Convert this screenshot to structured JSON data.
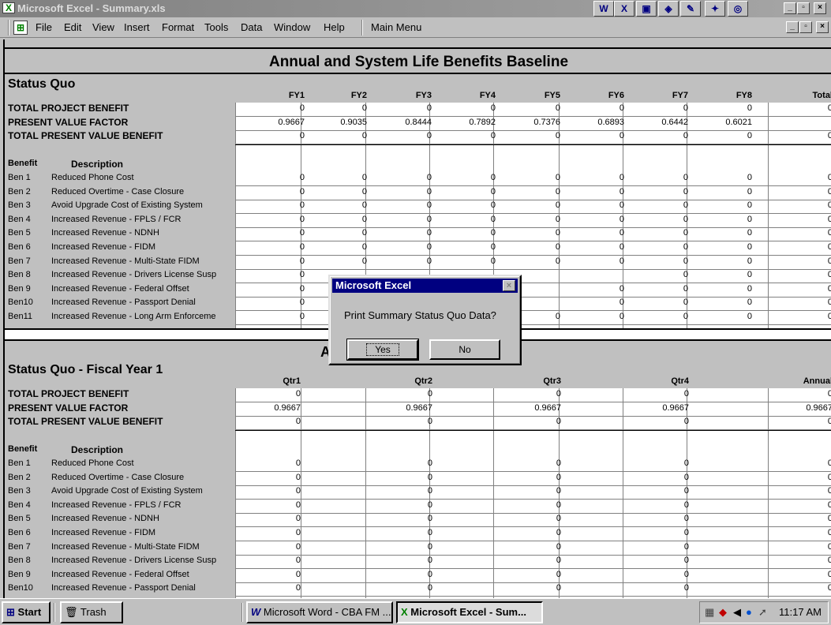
{
  "window": {
    "title": "Microsoft Excel - Summary.xls",
    "app_icon": "excel-icon",
    "office_shortcuts": [
      "W",
      "X",
      "▣",
      "◈",
      "✎",
      "✦",
      "◎"
    ],
    "controls": [
      "_",
      "▫",
      "×"
    ]
  },
  "menu": {
    "items": [
      "File",
      "Edit",
      "View",
      "Insert",
      "Format",
      "Tools",
      "Data",
      "Window",
      "Help",
      "Main Menu"
    ],
    "doc_controls": [
      "_",
      "▫",
      "×"
    ]
  },
  "sheet": {
    "main_title": "Annual and System Life Benefits Baseline",
    "section1": {
      "title": "Status Quo",
      "columns": [
        "FY1",
        "FY2",
        "FY3",
        "FY4",
        "FY5",
        "FY6",
        "FY7",
        "FY8",
        "Total"
      ],
      "summary_rows": [
        {
          "label": "TOTAL PROJECT BENEFIT",
          "values": [
            "0",
            "0",
            "0",
            "0",
            "0",
            "0",
            "0",
            "0",
            "0"
          ]
        },
        {
          "label": "PRESENT VALUE FACTOR",
          "values": [
            "0.9667",
            "0.9035",
            "0.8444",
            "0.7892",
            "0.7376",
            "0.6893",
            "0.6442",
            "0.6021",
            ""
          ]
        },
        {
          "label": "TOTAL PRESENT VALUE BENEFIT",
          "values": [
            "0",
            "0",
            "0",
            "0",
            "0",
            "0",
            "0",
            "0",
            "0"
          ]
        }
      ],
      "benefit_header": "Benefit",
      "description_header": "Description",
      "benefits": [
        {
          "code": "Ben 1",
          "desc": "Reduced Phone Cost",
          "values": [
            "0",
            "0",
            "0",
            "0",
            "0",
            "0",
            "0",
            "0",
            "0"
          ]
        },
        {
          "code": "Ben 2",
          "desc": "Reduced Overtime - Case Closure",
          "values": [
            "0",
            "0",
            "0",
            "0",
            "0",
            "0",
            "0",
            "0",
            "0"
          ]
        },
        {
          "code": "Ben 3",
          "desc": "Avoid Upgrade Cost of Existing System",
          "values": [
            "0",
            "0",
            "0",
            "0",
            "0",
            "0",
            "0",
            "0",
            "0"
          ]
        },
        {
          "code": "Ben 4",
          "desc": "Increased Revenue - FPLS / FCR",
          "values": [
            "0",
            "0",
            "0",
            "0",
            "0",
            "0",
            "0",
            "0",
            "0"
          ]
        },
        {
          "code": "Ben 5",
          "desc": "Increased Revenue - NDNH",
          "values": [
            "0",
            "0",
            "0",
            "0",
            "0",
            "0",
            "0",
            "0",
            "0"
          ]
        },
        {
          "code": "Ben 6",
          "desc": "Increased Revenue - FIDM",
          "values": [
            "0",
            "0",
            "0",
            "0",
            "0",
            "0",
            "0",
            "0",
            "0"
          ]
        },
        {
          "code": "Ben 7",
          "desc": "Increased Revenue - Multi-State FIDM",
          "values": [
            "0",
            "0",
            "0",
            "0",
            "0",
            "0",
            "0",
            "0",
            "0"
          ]
        },
        {
          "code": "Ben 8",
          "desc": "Increased Revenue - Drivers License Susp",
          "values": [
            "0",
            "",
            "",
            "",
            "",
            "",
            "0",
            "0",
            "0"
          ]
        },
        {
          "code": "Ben 9",
          "desc": "Increased Revenue - Federal Offset",
          "values": [
            "0",
            "",
            "",
            "",
            "",
            "0",
            "0",
            "0",
            "0"
          ]
        },
        {
          "code": "Ben10",
          "desc": "Increased Revenue - Passport Denial",
          "values": [
            "0",
            "",
            "",
            "",
            "",
            "0",
            "0",
            "0",
            "0"
          ]
        },
        {
          "code": "Ben11",
          "desc": "Increased Revenue - Long Arm Enforceme",
          "values": [
            "0",
            "",
            "",
            "",
            "0",
            "0",
            "0",
            "0",
            "0"
          ]
        }
      ]
    },
    "partial_heading": "A",
    "section2": {
      "title": "Status Quo - Fiscal Year 1",
      "columns": [
        "Qtr1",
        "Qtr2",
        "Qtr3",
        "Qtr4",
        "Annual"
      ],
      "summary_rows": [
        {
          "label": "TOTAL PROJECT BENEFIT",
          "values": [
            "0",
            "0",
            "0",
            "0",
            "0"
          ]
        },
        {
          "label": "PRESENT VALUE FACTOR",
          "values": [
            "0.9667",
            "0.9667",
            "0.9667",
            "0.9667",
            "0.9667"
          ]
        },
        {
          "label": "TOTAL PRESENT VALUE BENEFIT",
          "values": [
            "0",
            "0",
            "0",
            "0",
            "0"
          ]
        }
      ],
      "benefit_header": "Benefit",
      "description_header": "Description",
      "benefits": [
        {
          "code": "Ben 1",
          "desc": "Reduced Phone Cost",
          "values": [
            "0",
            "0",
            "0",
            "0",
            "0"
          ]
        },
        {
          "code": "Ben 2",
          "desc": "Reduced Overtime - Case Closure",
          "values": [
            "0",
            "0",
            "0",
            "0",
            "0"
          ]
        },
        {
          "code": "Ben 3",
          "desc": "Avoid Upgrade Cost of Existing System",
          "values": [
            "0",
            "0",
            "0",
            "0",
            "0"
          ]
        },
        {
          "code": "Ben 4",
          "desc": "Increased Revenue - FPLS / FCR",
          "values": [
            "0",
            "0",
            "0",
            "0",
            "0"
          ]
        },
        {
          "code": "Ben 5",
          "desc": "Increased Revenue - NDNH",
          "values": [
            "0",
            "0",
            "0",
            "0",
            "0"
          ]
        },
        {
          "code": "Ben 6",
          "desc": "Increased Revenue - FIDM",
          "values": [
            "0",
            "0",
            "0",
            "0",
            "0"
          ]
        },
        {
          "code": "Ben 7",
          "desc": "Increased Revenue - Multi-State FIDM",
          "values": [
            "0",
            "0",
            "0",
            "0",
            "0"
          ]
        },
        {
          "code": "Ben 8",
          "desc": "Increased Revenue - Drivers License Susp",
          "values": [
            "0",
            "0",
            "0",
            "0",
            "0"
          ]
        },
        {
          "code": "Ben 9",
          "desc": "Increased Revenue - Federal Offset",
          "values": [
            "0",
            "0",
            "0",
            "0",
            "0"
          ]
        },
        {
          "code": "Ben10",
          "desc": "Increased Revenue - Passport Denial",
          "values": [
            "0",
            "0",
            "0",
            "0",
            "0"
          ]
        }
      ]
    }
  },
  "dialog": {
    "title": "Microsoft Excel",
    "message": "Print Summary Status Quo Data?",
    "yes_label": "Yes",
    "no_label": "No",
    "close_glyph": "×"
  },
  "taskbar": {
    "start_label": "Start",
    "items": [
      {
        "label": "Trash"
      },
      {
        "label": "Microsoft Word - CBA FM ..."
      },
      {
        "label": "Microsoft Excel - Sum..."
      }
    ],
    "clock": "11:17 AM",
    "tray_icons": [
      "network-icon",
      "shield-icon",
      "speaker-icon",
      "messenger-icon",
      "arrow-icon"
    ]
  },
  "colors": {
    "title_inactive": "#808080",
    "dialog_title": "#000080",
    "face": "#c0c0c0"
  }
}
